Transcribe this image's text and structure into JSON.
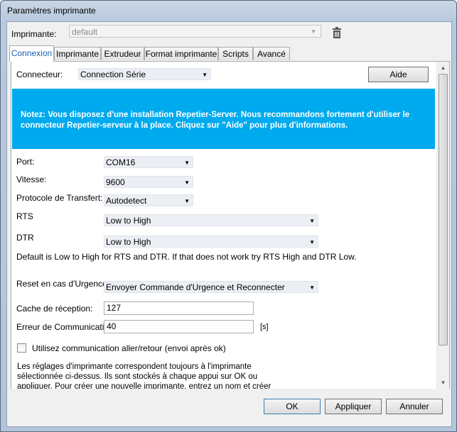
{
  "window": {
    "title": "Paramètres imprimante"
  },
  "printer": {
    "label": "Imprimante:",
    "value": "default"
  },
  "tabs": [
    {
      "label": "Connexion"
    },
    {
      "label": "Imprimante"
    },
    {
      "label": "Extrudeur"
    },
    {
      "label": "Format imprimante"
    },
    {
      "label": "Scripts"
    },
    {
      "label": "Avancé"
    }
  ],
  "connexion": {
    "connector_label": "Connecteur:",
    "connector_value": "Connection Série",
    "help_button": "Aide",
    "notice": "Notez: Vous disposez d'une installation Repetier-Server. Nous recommandons fortement d'utiliser le connecteur Repetier-serveur à la place. Cliquez sur \"Aide\" pour plus d'informations.",
    "port_label": "Port:",
    "port_value": "COM16",
    "speed_label": "Vitesse:",
    "speed_value": "9600",
    "protocol_label": "Protocole de Transfert:",
    "protocol_value": "Autodetect",
    "rts_label": "RTS",
    "rts_value": "Low to High",
    "dtr_label": "DTR",
    "dtr_value": "Low to High",
    "rts_dtr_note": "Default is Low to High for RTS and DTR. If that does not work try RTS High and DTR Low.",
    "reset_label": "Reset en cas d'Urgence",
    "reset_value": "Envoyer Commande d'Urgence et Reconnecter",
    "cache_label": "Cache de réception:",
    "cache_value": "127",
    "error_label": "Erreur de Communication:",
    "error_value": "40",
    "error_unit": "[s]",
    "pingpong_label": "Utilisez communication aller/retour (envoi après ok)",
    "info_text": "Les réglages d'imprimante correspondent toujours à l'imprimante sélectionnée ci-dessus. Ils sont stockés à chaque appui sur OK ou appliquer. Pour créer une nouvelle imprimante, entrez un nom et créer appliquer. L'imprimante démarre"
  },
  "footer": {
    "ok": "OK",
    "apply": "Appliquer",
    "cancel": "Annuler"
  }
}
